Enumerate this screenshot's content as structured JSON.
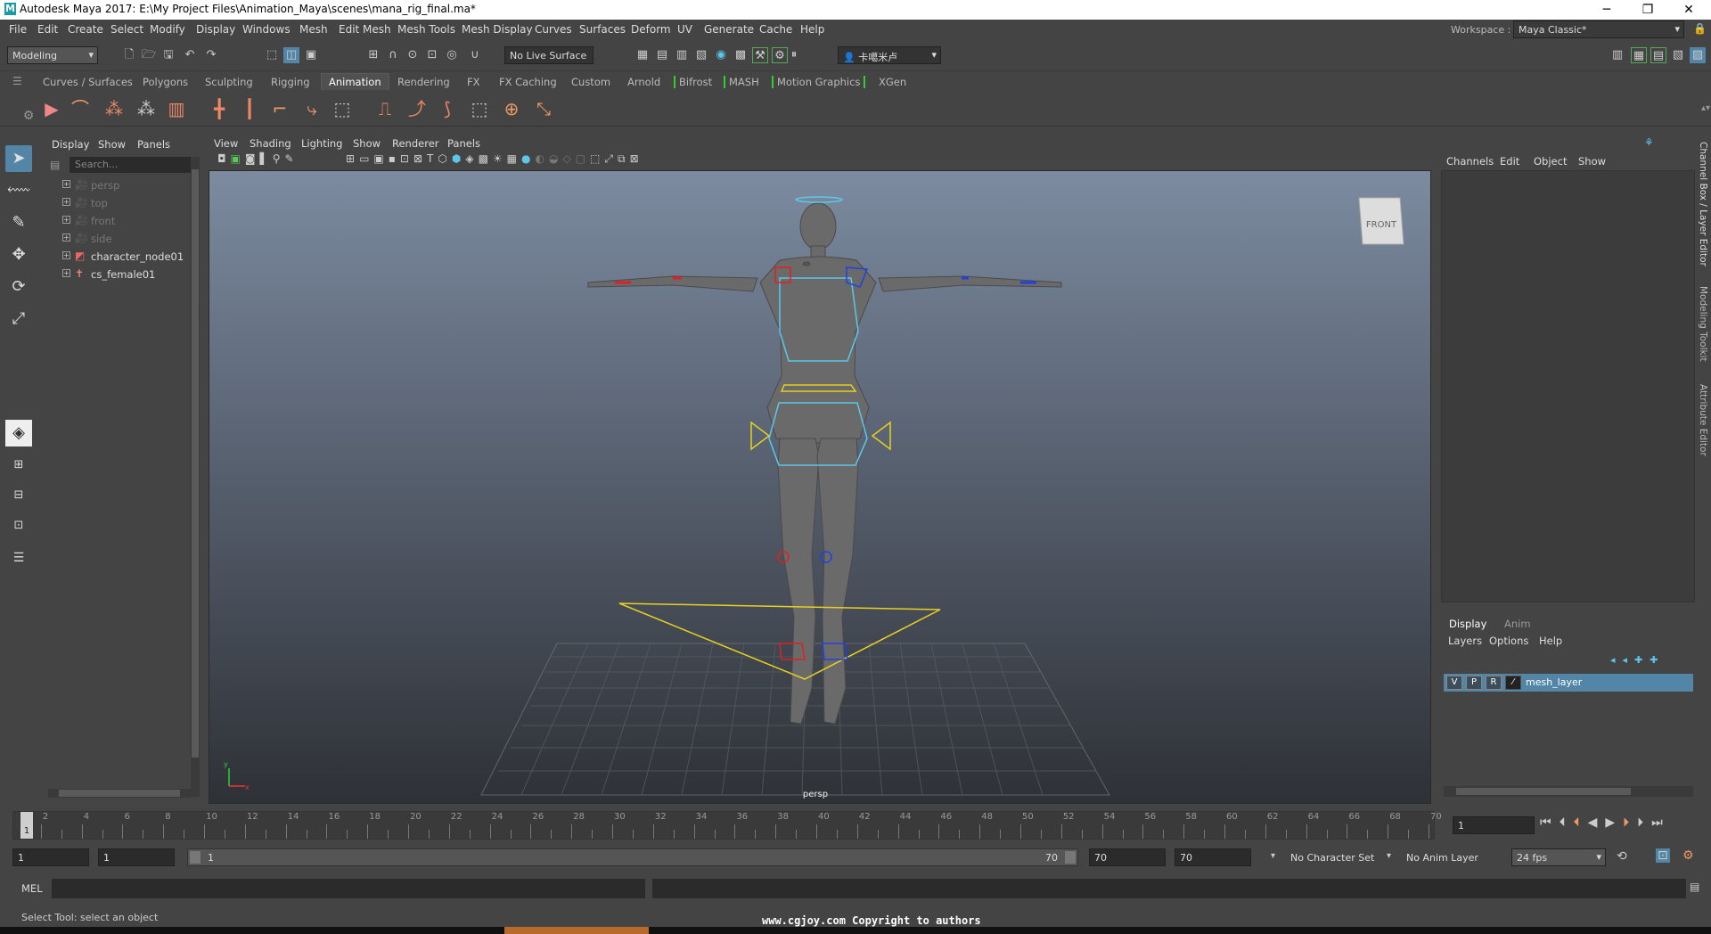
{
  "titlebar": {
    "title": "Autodesk Maya 2017: E:\\My Project Files\\Animation_Maya\\scenes\\mana_rig_final.ma*",
    "minimize": "─",
    "restore": "❐",
    "close": "✕"
  },
  "menubar": {
    "items": [
      "File",
      "Edit",
      "Create",
      "Select",
      "Modify",
      "Display",
      "Windows",
      "Mesh",
      "Edit Mesh",
      "Mesh Tools",
      "Mesh Display",
      "Curves",
      "Surfaces",
      "Deform",
      "UV",
      "Generate",
      "Cache",
      "Help"
    ],
    "workspace_label": "Workspace :",
    "workspace_value": "Maya Classic*"
  },
  "statusline": {
    "menuset": "Modeling",
    "live_surface": "No Live Surface",
    "user": "卡噶米卢"
  },
  "shelf": {
    "tabs": [
      "Curves / Surfaces",
      "Polygons",
      "Sculpting",
      "Rigging",
      "Animation",
      "Rendering",
      "FX",
      "FX Caching",
      "Custom",
      "Arnold",
      "Bifrost",
      "MASH",
      "Motion Graphics",
      "XGen"
    ],
    "active_tab": "Animation"
  },
  "outliner": {
    "menus": [
      "Display",
      "Show",
      "Panels"
    ],
    "search_placeholder": "Search...",
    "items": [
      {
        "label": "persp",
        "icon": "camera-icon",
        "dim": true
      },
      {
        "label": "top",
        "icon": "camera-icon",
        "dim": true
      },
      {
        "label": "front",
        "icon": "camera-icon",
        "dim": true
      },
      {
        "label": "side",
        "icon": "camera-icon",
        "dim": true
      },
      {
        "label": "character_node01",
        "icon": "character-set-icon",
        "dim": false
      },
      {
        "label": "cs_female01",
        "icon": "joint-figure-icon",
        "dim": false
      }
    ]
  },
  "viewport": {
    "menus": [
      "View",
      "Shading",
      "Lighting",
      "Show",
      "Renderer",
      "Panels"
    ],
    "camera_label": "persp",
    "viewcube_label": "FRONT"
  },
  "channelbox": {
    "menus": [
      "Channels",
      "Edit",
      "Object",
      "Show"
    ]
  },
  "layers": {
    "tabs": [
      "Display",
      "Anim"
    ],
    "active_tab": "Display",
    "menus": [
      "Layers",
      "Options",
      "Help"
    ],
    "layer": {
      "v": "V",
      "p": "P",
      "r": "R",
      "name": "mesh_layer"
    }
  },
  "sidetabs": [
    "Channel Box / Layer Editor",
    "Modeling Toolkit",
    "Attribute Editor"
  ],
  "timeslider": {
    "ticks": [
      "2",
      "4",
      "6",
      "8",
      "10",
      "12",
      "14",
      "16",
      "18",
      "20",
      "22",
      "24",
      "26",
      "28",
      "30",
      "32",
      "34",
      "36",
      "38",
      "40",
      "42",
      "44",
      "46",
      "48",
      "50",
      "52",
      "54",
      "56",
      "58",
      "60",
      "62",
      "64",
      "66",
      "68",
      "70"
    ],
    "current_frame": "1",
    "current_frame_field": "1"
  },
  "range": {
    "start": "1",
    "playback_start": "1",
    "slider_start": "1",
    "slider_end": "70",
    "playback_end": "70",
    "end": "70",
    "character_set": "No Character Set",
    "anim_layer": "No Anim Layer",
    "fps": "24 fps"
  },
  "cmdline": {
    "lang": "MEL"
  },
  "helpline": {
    "text": "Select Tool: select an object"
  },
  "watermark": "www.cgjoy.com Copyright to authors",
  "colors": {
    "accent": "#5285a6",
    "rig_cyan": "#5bc8ea",
    "rig_yellow": "#e8d020",
    "rig_red": "#e02020",
    "rig_blue": "#2040e0"
  }
}
